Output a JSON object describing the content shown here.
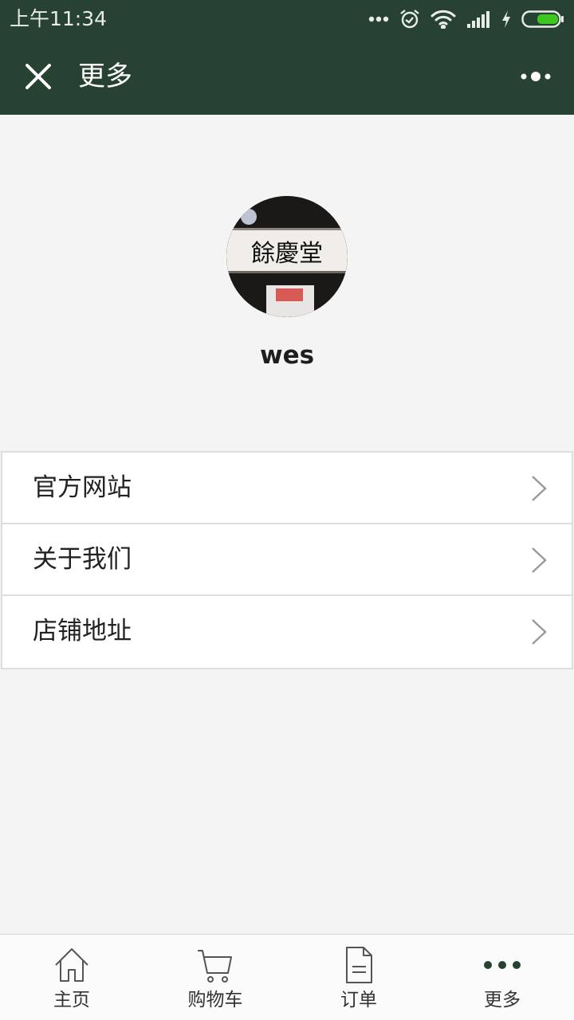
{
  "status_bar": {
    "time": "上午11:34",
    "icons": [
      "more-dots-icon",
      "alarm-icon",
      "wifi-icon",
      "signal-icon",
      "charging-icon",
      "battery-icon"
    ]
  },
  "title_bar": {
    "title": "更多",
    "close_icon": "close-icon",
    "menu_icon": "more-menu-icon"
  },
  "profile": {
    "username": "wes",
    "avatar_sign_text": "餘慶堂"
  },
  "menu": {
    "items": [
      {
        "label": "官方网站",
        "icon": "chevron-right-icon"
      },
      {
        "label": "关于我们",
        "icon": "chevron-right-icon"
      },
      {
        "label": "店铺地址",
        "icon": "chevron-right-icon"
      }
    ]
  },
  "tab_bar": {
    "tabs": [
      {
        "label": "主页",
        "icon": "home-icon",
        "active": false
      },
      {
        "label": "购物车",
        "icon": "cart-icon",
        "active": false
      },
      {
        "label": "订单",
        "icon": "document-icon",
        "active": false
      },
      {
        "label": "更多",
        "icon": "more-dots-icon",
        "active": true
      }
    ]
  },
  "colors": {
    "header_bg": "#274232",
    "page_bg": "#f4f4f4",
    "battery_green": "#3cc61f",
    "active_tab_icon": "#274232"
  }
}
